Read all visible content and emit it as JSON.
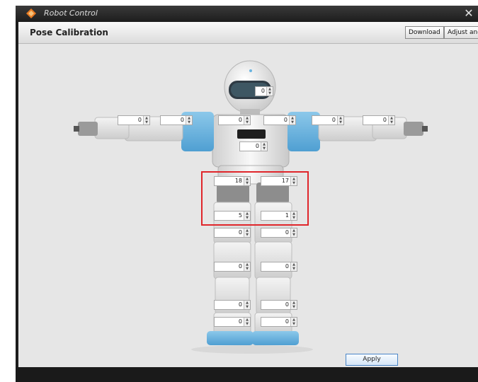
{
  "window": {
    "title": "Robot Control",
    "close_glyph": "✕"
  },
  "header": {
    "title": "Pose Calibration",
    "buttons": [
      "Download",
      "Adjust angle"
    ]
  },
  "joints": {
    "head": "0",
    "left_hand": "0",
    "left_elbow": "0",
    "left_shoulder": "0",
    "right_shoulder": "0",
    "right_elbow": "0",
    "right_hand": "0",
    "chest": "0",
    "left_hip": "18",
    "right_hip": "17",
    "left_thigh": "5",
    "right_thigh": "1",
    "left_upper_knee": "0",
    "right_upper_knee": "0",
    "left_knee": "0",
    "right_knee": "0",
    "left_ankle": "0",
    "right_ankle": "0",
    "left_foot": "0",
    "right_foot": "0"
  },
  "apply_label": "Apply",
  "colors": {
    "accent_blue": "#6ab4e0",
    "highlight_red": "#e0262b"
  },
  "icons": {
    "app": "robot-logo-icon",
    "close": "close-icon",
    "spinner_up": "arrow-up-icon",
    "spinner_down": "arrow-down-icon"
  }
}
